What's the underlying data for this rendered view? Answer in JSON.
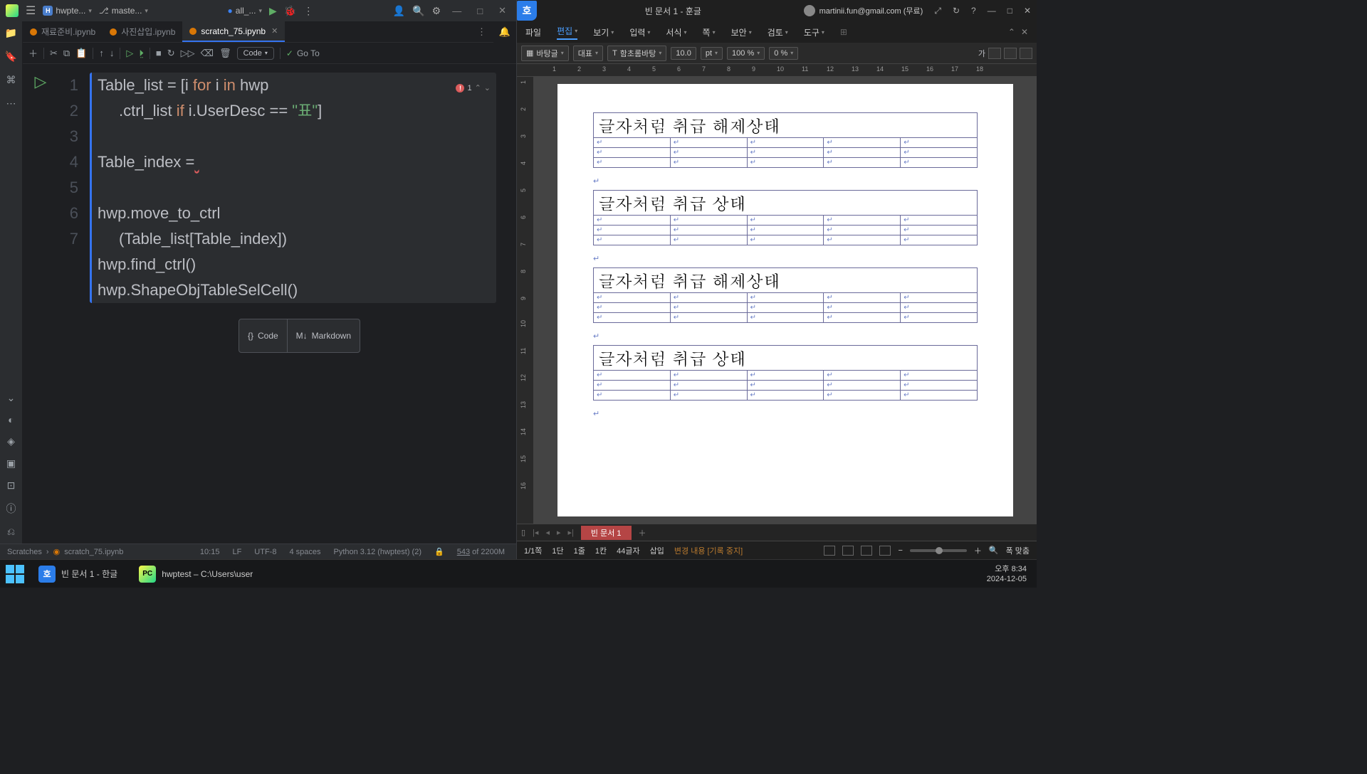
{
  "ide": {
    "project": "hwpte...",
    "branch": "maste...",
    "runconfig": "all_...",
    "tabs": [
      {
        "label": "재료준비.ipynb",
        "active": false
      },
      {
        "label": "사진삽입.ipynb",
        "active": false
      },
      {
        "label": "scratch_75.ipynb",
        "active": true
      }
    ],
    "toolbar": {
      "code": "Code",
      "goto": "Go To"
    },
    "errors": "1",
    "lines": [
      "1",
      "2",
      "3",
      "4",
      "5",
      "6",
      "7"
    ],
    "code": {
      "l1a": "Table_list = [i ",
      "l1for": "for",
      "l1b": " i ",
      "l1in": "in",
      "l1c": " hwp",
      "l2a": ".ctrl_list ",
      "l2if": "if",
      "l2b": " i.UserDesc == ",
      "l2str": "\"표\"",
      "l2c": "]",
      "l3": "Table_index =",
      "l5a": "hwp.move_to_ctrl",
      "l5b": "(Table_list[Table_index])",
      "l6": "hwp.find_ctrl()",
      "l7": "hwp.ShapeObjTableSelCell()"
    },
    "insert_code": "Code",
    "insert_md": "Markdown",
    "status": {
      "crumb1": "Scratches",
      "crumb2": "scratch_75.ipynb",
      "pos": "10:15",
      "eol": "LF",
      "enc": "UTF-8",
      "indent": "4 spaces",
      "interp": "Python 3.12 (hwptest) (2)",
      "mem": "543 of 2200M"
    }
  },
  "hwp": {
    "title": "빈 문서 1 - 훈글",
    "user": "martinii.fun@gmail.com (무료)",
    "menu": [
      "파일",
      "편집",
      "보기",
      "입력",
      "서식",
      "쪽",
      "보안",
      "검토",
      "도구"
    ],
    "tool": {
      "style": "바탕글",
      "para": "대표",
      "font": "함초롬바탕",
      "size": "10.0",
      "unit": "pt",
      "zoom": "100 %",
      "spacing": "0 %",
      "ga": "가"
    },
    "rulerH": [
      "1",
      "2",
      "3",
      "4",
      "5",
      "6",
      "7",
      "8",
      "9",
      "10",
      "11",
      "12",
      "13",
      "14",
      "15",
      "16",
      "17",
      "18"
    ],
    "rulerV": [
      "1",
      "2",
      "3",
      "4",
      "5",
      "6",
      "7",
      "8",
      "9",
      "10",
      "11",
      "12",
      "13",
      "14",
      "15",
      "16"
    ],
    "tables": [
      "글자처럼 취급 해제상태",
      "글자처럼 취급 상태",
      "글자처럼 취급 해제상태",
      "글자처럼 취급 상태"
    ],
    "doctab": "빈 문서 1",
    "status": {
      "page": "1/1쪽",
      "dan": "1단",
      "line": "1줄",
      "col": "1칸",
      "chars": "44글자",
      "mode": "삽입",
      "rec": "변경 내용 [기록 중지]",
      "fit": "폭 맞춤"
    }
  },
  "taskbar": {
    "hwp": "빈 문서 1 - 한글",
    "pc": "hwptest – C:\\Users\\user",
    "time": "오후 8:34",
    "date": "2024-12-05"
  }
}
